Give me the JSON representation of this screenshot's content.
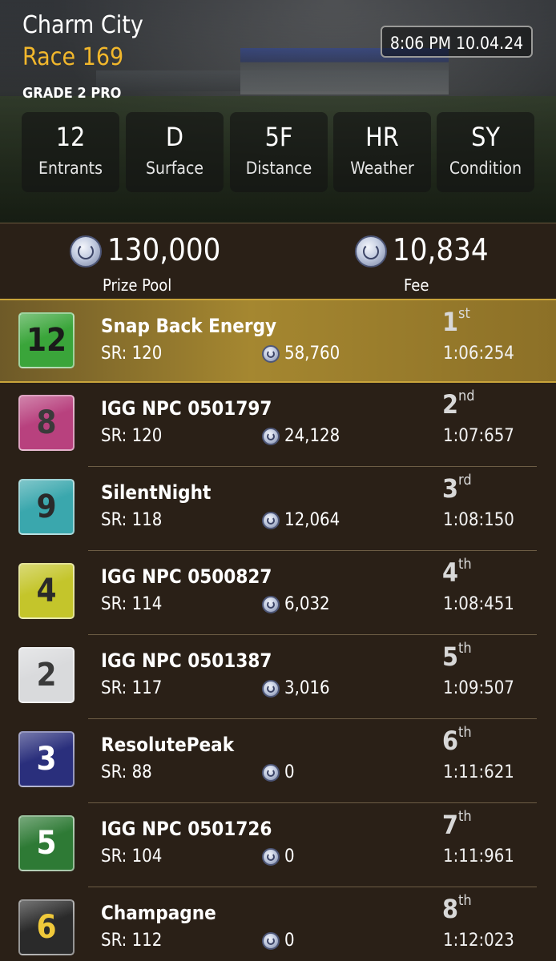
{
  "race": {
    "track": "Charm City",
    "race_name": "Race 169",
    "grade": "GRADE 2 PRO",
    "datetime": "8:06 PM 10.04.24"
  },
  "stats": [
    {
      "value": "12",
      "label": "Entrants"
    },
    {
      "value": "D",
      "label": "Surface"
    },
    {
      "value": "5F",
      "label": "Distance"
    },
    {
      "value": "HR",
      "label": "Weather"
    },
    {
      "value": "SY",
      "label": "Condition"
    }
  ],
  "prize": {
    "pool_amount": "130,000",
    "pool_label": "Prize Pool",
    "fee_amount": "10,834",
    "fee_label": "Fee"
  },
  "results": [
    {
      "gate": "12",
      "name": "Snap Back Energy",
      "sr": "SR: 120",
      "earnings": "58,760",
      "place_num": "1",
      "place_suffix": "st",
      "time": "1:06:254",
      "badge_color": "#3aa53a",
      "badge_text_color": "#1a1a1a"
    },
    {
      "gate": "8",
      "name": "IGG NPC 0501797",
      "sr": "SR: 120",
      "earnings": "24,128",
      "place_num": "2",
      "place_suffix": "nd",
      "time": "1:07:657",
      "badge_color": "#b8417e",
      "badge_text_color": "#3a3a3a"
    },
    {
      "gate": "9",
      "name": "SilentNight",
      "sr": "SR: 118",
      "earnings": "12,064",
      "place_num": "3",
      "place_suffix": "rd",
      "time": "1:08:150",
      "badge_color": "#3aa7ad",
      "badge_text_color": "#2a2a2a"
    },
    {
      "gate": "4",
      "name": "IGG NPC 0500827",
      "sr": "SR: 114",
      "earnings": "6,032",
      "place_num": "4",
      "place_suffix": "th",
      "time": "1:08:451",
      "badge_color": "#c4c52b",
      "badge_text_color": "#2a2a2a"
    },
    {
      "gate": "2",
      "name": "IGG NPC 0501387",
      "sr": "SR: 117",
      "earnings": "3,016",
      "place_num": "5",
      "place_suffix": "th",
      "time": "1:09:507",
      "badge_color": "#d9dadc",
      "badge_text_color": "#3a3a3a"
    },
    {
      "gate": "3",
      "name": "ResolutePeak",
      "sr": "SR: 88",
      "earnings": "0",
      "place_num": "6",
      "place_suffix": "th",
      "time": "1:11:621",
      "badge_color": "#2a2f7c",
      "badge_text_color": "#ffffff"
    },
    {
      "gate": "5",
      "name": "IGG NPC 0501726",
      "sr": "SR: 104",
      "earnings": "0",
      "place_num": "7",
      "place_suffix": "th",
      "time": "1:11:961",
      "badge_color": "#2e7a35",
      "badge_text_color": "#ffffff"
    },
    {
      "gate": "6",
      "name": "Champagne",
      "sr": "SR: 112",
      "earnings": "0",
      "place_num": "8",
      "place_suffix": "th",
      "time": "1:12:023",
      "badge_color": "#2a2a2a",
      "badge_text_color": "#f0c93a"
    }
  ]
}
